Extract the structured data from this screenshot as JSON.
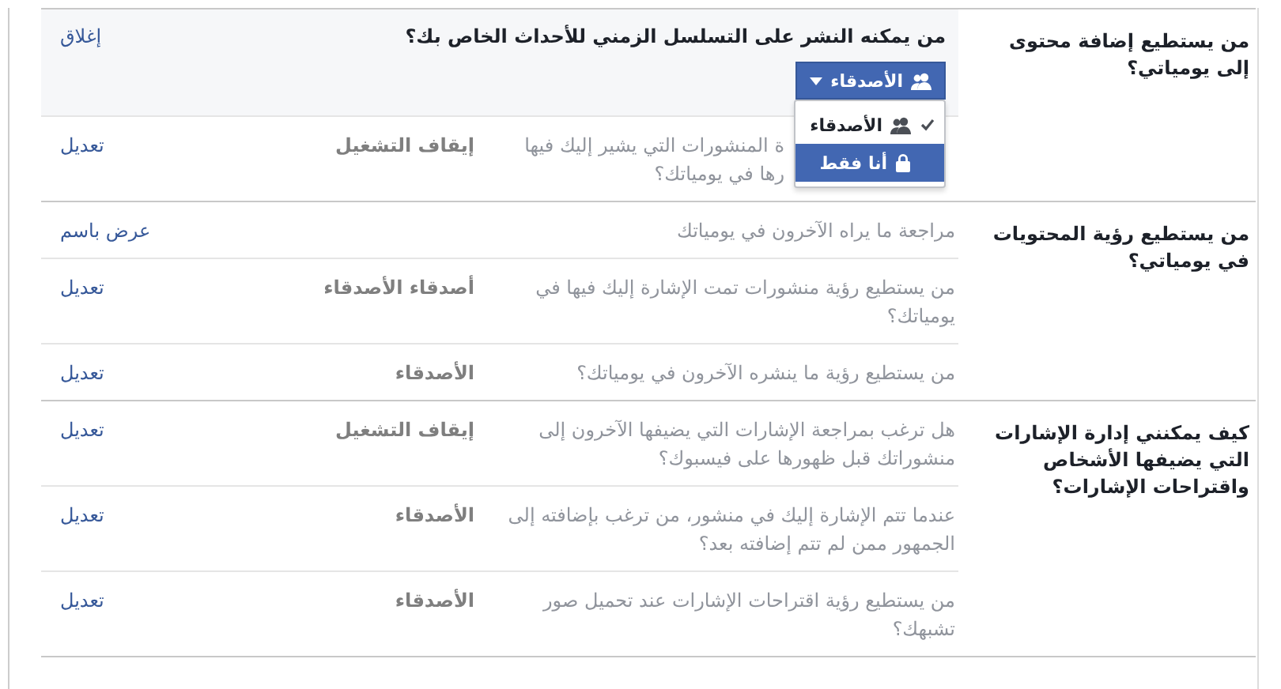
{
  "sections": [
    {
      "heading": "من يستطيع إضافة محتوى إلى يومياتي؟",
      "editor": {
        "question": "من يمكنه النشر على التسلسل الزمني للأحداث الخاص بك؟",
        "close_link": "إغلاق",
        "privacy_button": "الأصدقاء",
        "menu": [
          {
            "label": "الأصدقاء",
            "checked": true,
            "highlighted": false
          },
          {
            "label": "أنا فقط",
            "checked": false,
            "highlighted": true
          }
        ]
      },
      "rows": [
        {
          "question_lines": [
            "ة المنشورات التي يشير إليك فيها",
            "رها في يومياتك؟"
          ],
          "value": "إيقاف التشغيل",
          "action": "تعديل"
        }
      ]
    },
    {
      "heading": "من يستطيع رؤية المحتويات في يومياتي؟",
      "rows": [
        {
          "question": "مراجعة ما يراه الآخرون في يومياتك",
          "action": "عرض باسم"
        },
        {
          "question": "من يستطيع رؤية منشورات تمت الإشارة إليك فيها في يومياتك؟",
          "value": "أصدقاء الأصدقاء",
          "action": "تعديل"
        },
        {
          "question": "من يستطيع رؤية ما ينشره الآخرون في يومياتك؟",
          "value": "الأصدقاء",
          "action": "تعديل"
        }
      ]
    },
    {
      "heading": "كيف يمكنني إدارة الإشارات التي يضيفها الأشخاص واقتراحات الإشارات؟",
      "rows": [
        {
          "question": "هل ترغب بمراجعة الإشارات التي يضيفها الآخرون إلى منشوراتك قبل ظهورها على فيسبوك؟",
          "value": "إيقاف التشغيل",
          "action": "تعديل"
        },
        {
          "question": "عندما تتم الإشارة إليك في منشور، من ترغب بإضافته إلى الجمهور ممن لم تتم إضافته بعد؟",
          "value": "الأصدقاء",
          "action": "تعديل"
        },
        {
          "question": "من يستطيع رؤية اقتراحات الإشارات عند تحميل صور تشبهك؟",
          "value": "الأصدقاء",
          "action": "تعديل"
        }
      ]
    }
  ]
}
